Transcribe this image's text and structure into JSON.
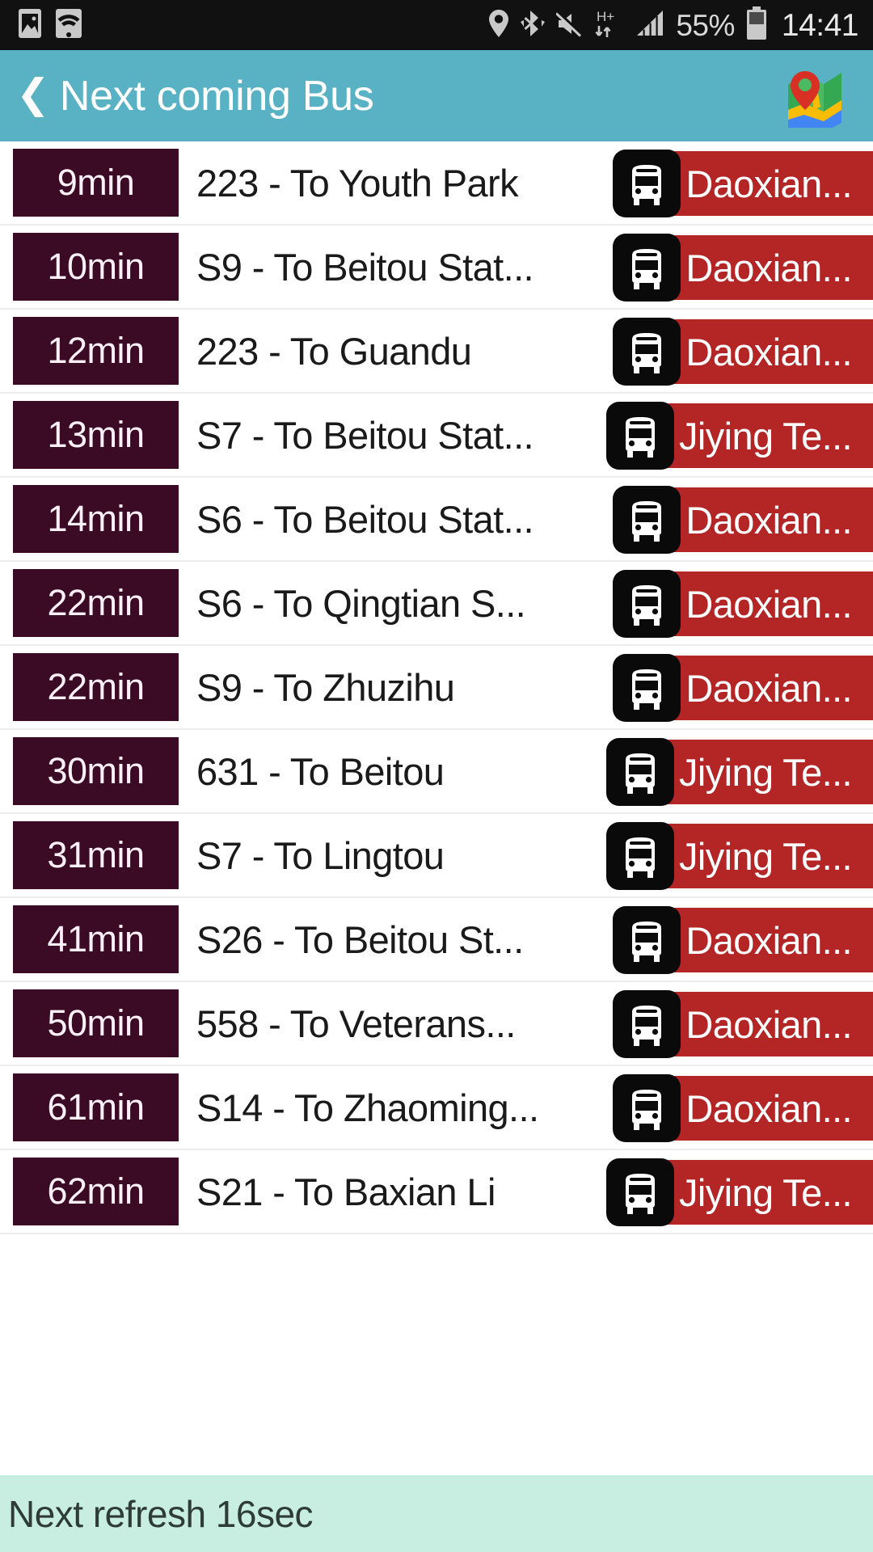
{
  "status_bar": {
    "icons_left": [
      "screenshot-icon",
      "wifi-icon"
    ],
    "icons_right": [
      "location-icon",
      "bluetooth-icon",
      "mute-icon",
      "hsdpa-icon",
      "signal-icon"
    ],
    "network_label": "H+",
    "battery_percent": "55%",
    "clock": "14:41"
  },
  "header": {
    "back_label": "❮",
    "title": "Next coming Bus",
    "map_icon": "google-maps-icon"
  },
  "list": {
    "rows": [
      {
        "eta": "9min",
        "route": "223 - To Youth Park",
        "bus_icon": "bus-icon",
        "stop": "Daoxian..."
      },
      {
        "eta": "10min",
        "route": "S9 - To Beitou Stat...",
        "bus_icon": "bus-icon",
        "stop": "Daoxian..."
      },
      {
        "eta": "12min",
        "route": "223 - To Guandu",
        "bus_icon": "bus-icon",
        "stop": "Daoxian..."
      },
      {
        "eta": "13min",
        "route": "S7 - To Beitou Stat...",
        "bus_icon": "bus-icon",
        "stop": "Jiying Te..."
      },
      {
        "eta": "14min",
        "route": "S6 - To Beitou Stat...",
        "bus_icon": "bus-icon",
        "stop": "Daoxian..."
      },
      {
        "eta": "22min",
        "route": "S6 - To Qingtian S...",
        "bus_icon": "bus-icon",
        "stop": "Daoxian..."
      },
      {
        "eta": "22min",
        "route": "S9 - To Zhuzihu",
        "bus_icon": "bus-icon",
        "stop": "Daoxian..."
      },
      {
        "eta": "30min",
        "route": "631 - To Beitou",
        "bus_icon": "bus-icon",
        "stop": "Jiying Te..."
      },
      {
        "eta": "31min",
        "route": "S7 - To Lingtou",
        "bus_icon": "bus-icon",
        "stop": "Jiying Te..."
      },
      {
        "eta": "41min",
        "route": "S26 - To Beitou St...",
        "bus_icon": "bus-icon",
        "stop": "Daoxian..."
      },
      {
        "eta": "50min",
        "route": "558 - To Veterans...",
        "bus_icon": "bus-icon",
        "stop": "Daoxian..."
      },
      {
        "eta": "61min",
        "route": "S14 - To Zhaoming...",
        "bus_icon": "bus-icon",
        "stop": "Daoxian..."
      },
      {
        "eta": "62min",
        "route": "S21 - To Baxian Li",
        "bus_icon": "bus-icon",
        "stop": "Jiying Te..."
      }
    ]
  },
  "footer": {
    "refresh_text": "Next refresh 16sec"
  },
  "colors": {
    "appbar": "#58b2c4",
    "eta_badge": "#3b0a24",
    "stop_pill": "#b42525",
    "footer": "#c8eee2",
    "statusbar": "#111111"
  }
}
